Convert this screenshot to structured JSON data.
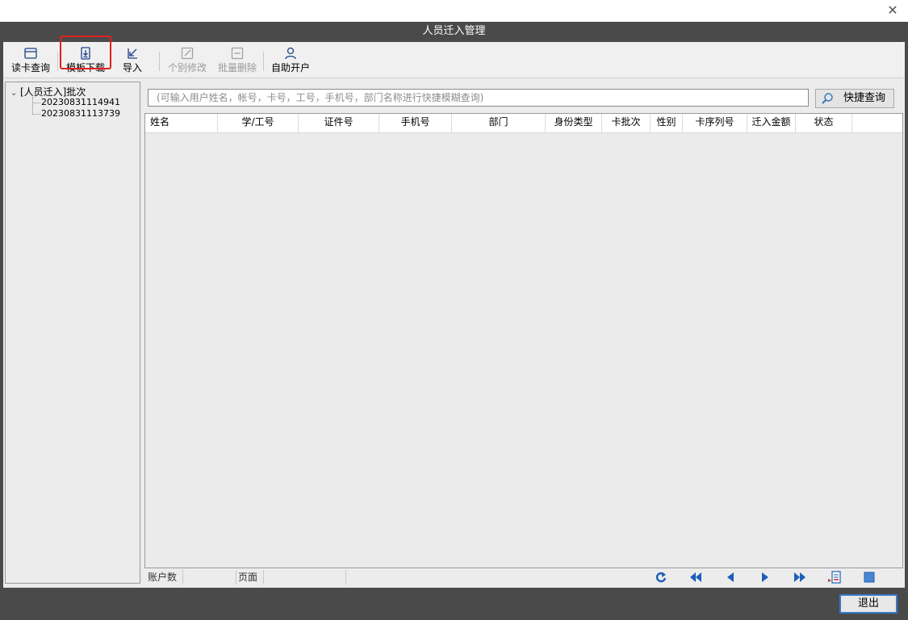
{
  "window": {
    "title": "人员迁入管理"
  },
  "toolbar": {
    "read_card": "读卡查询",
    "template_download": "模板下载",
    "import": "导入",
    "single_edit": "个别修改",
    "batch_delete": "批量删除",
    "self_open": "自助开户"
  },
  "tree": {
    "root": "[人员迁入]批次",
    "children": [
      "20230831114941",
      "20230831113739"
    ]
  },
  "search": {
    "placeholder": "(可输入用户姓名，帐号，卡号，工号，手机号，部门名称进行快捷模糊查询)",
    "button": "快捷查询"
  },
  "grid": {
    "columns": [
      "姓名",
      "学/工号",
      "证件号",
      "手机号",
      "部门",
      "身份类型",
      "卡批次",
      "性别",
      "卡序列号",
      "迁入金额",
      "状态"
    ],
    "rows": []
  },
  "status": {
    "account_count_label": "账户数",
    "page_label": "页面"
  },
  "footer": {
    "exit": "退出"
  },
  "colors": {
    "frame": "#4a4a4a",
    "client": "#ececec",
    "accent_blue": "#1c5fb8",
    "highlight_red": "#e02020"
  }
}
